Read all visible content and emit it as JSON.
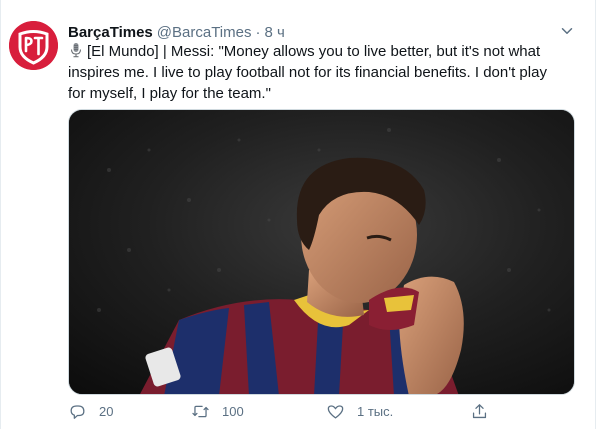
{
  "tweet": {
    "display_name": "BarçaTimes",
    "handle": "@BarcaTimes",
    "separator": "·",
    "time": "8 ч",
    "text": "[El Mundo] | Messi: \"Money allows you to live better, but it's not what inspires me. I live to play football not for its financial benefits. I don't play for myself, I play for the team.\"",
    "avatar_icon": "barcatimes-logo",
    "media_description_icon": "photo"
  },
  "actions": {
    "reply_count": "20",
    "retweet_count": "100",
    "like_count": "1 тыс."
  },
  "colors": {
    "secondary_text": "#5b7083",
    "avatar_bg": "#d81e3c",
    "border": "#e6ecf0"
  }
}
